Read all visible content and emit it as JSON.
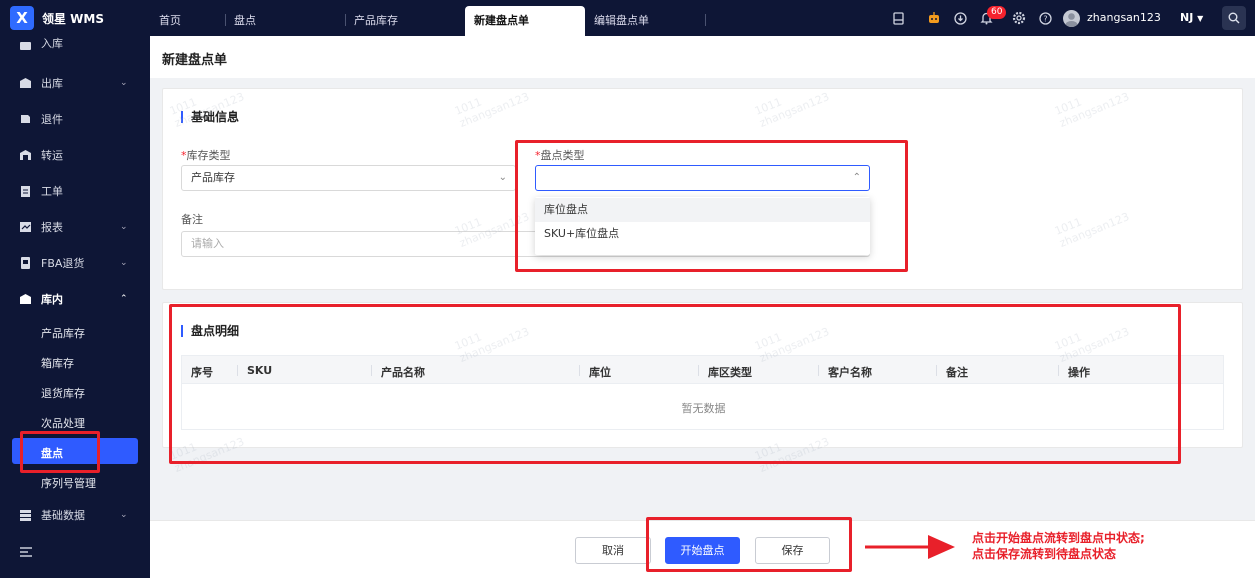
{
  "app": {
    "logo_letter": "X",
    "name": "领星 WMS"
  },
  "tabs": [
    {
      "label": "首页"
    },
    {
      "label": "盘点"
    },
    {
      "label": "产品库存"
    },
    {
      "label": "新建盘点单",
      "active": true
    },
    {
      "label": "编辑盘点单"
    }
  ],
  "header": {
    "notification_count": "60",
    "username": "zhangsan123",
    "warehouse": "NJ",
    "icons": [
      "printer-icon",
      "robot-icon",
      "download-icon",
      "bell-icon",
      "gear-icon",
      "help-icon",
      "avatar",
      "search-icon"
    ]
  },
  "sidebar": {
    "items": [
      {
        "label": "入库",
        "icon": "inbound-icon"
      },
      {
        "label": "出库",
        "icon": "outbound-icon",
        "has_children": true
      },
      {
        "label": "退件",
        "icon": "return-icon"
      },
      {
        "label": "转运",
        "icon": "transfer-icon"
      },
      {
        "label": "工单",
        "icon": "workorder-icon"
      },
      {
        "label": "报表",
        "icon": "report-icon",
        "has_children": true
      },
      {
        "label": "FBA退货",
        "icon": "fba-icon",
        "has_children": true
      },
      {
        "label": "库内",
        "icon": "warehouse-icon",
        "expanded": true
      },
      {
        "label": "基础数据",
        "icon": "basedata-icon",
        "has_children": true
      }
    ],
    "sub_items": [
      {
        "label": "产品库存"
      },
      {
        "label": "箱库存"
      },
      {
        "label": "退货库存"
      },
      {
        "label": "次品处理"
      },
      {
        "label": "盘点",
        "active": true
      },
      {
        "label": "序列号管理"
      }
    ],
    "collapse_icon": "collapse-menu-icon"
  },
  "page": {
    "title": "新建盘点单"
  },
  "basic_info": {
    "title": "基础信息",
    "stock_type": {
      "label": "库存类型",
      "required": true,
      "value": "产品库存"
    },
    "count_type": {
      "label": "盘点类型",
      "required": true,
      "value": "",
      "open": true,
      "options": [
        "库位盘点",
        "SKU+库位盘点"
      ],
      "highlighted": "库位盘点"
    },
    "remark": {
      "label": "备注",
      "placeholder": "请输入"
    }
  },
  "detail": {
    "title": "盘点明细",
    "columns": [
      "序号",
      "SKU",
      "产品名称",
      "库位",
      "库区类型",
      "客户名称",
      "备注",
      "操作"
    ],
    "rows": [],
    "empty_text": "暂无数据"
  },
  "footer": {
    "cancel_label": "取消",
    "start_label": "开始盘点",
    "save_label": "保存"
  },
  "annotation": {
    "color": "#e8202a",
    "line1": "点击开始盘点流转到盘点中状态;",
    "line2": "点击保存流转到待盘点状态"
  },
  "watermark": {
    "line1": "1011",
    "line2": "zhangsan123"
  },
  "colors": {
    "primary": "#2f5bff",
    "nav_bg": "#0e1636",
    "annotation": "#e8202a"
  }
}
